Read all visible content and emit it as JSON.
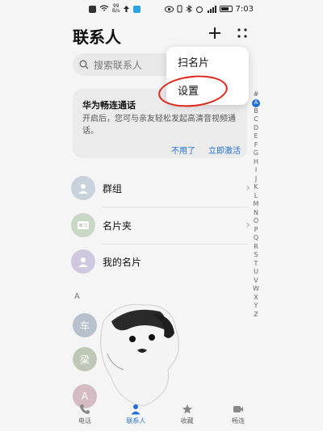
{
  "status_bar": {
    "net_speed": "99\nB/s",
    "time": "7:03"
  },
  "header": {
    "title": "联系人"
  },
  "search": {
    "placeholder": "搜索联系人"
  },
  "popup_menu": {
    "items": [
      "扫名片",
      "设置"
    ]
  },
  "promo": {
    "title": "华为畅连通话",
    "text": "开启后，您可与亲友轻松发起高清音视频通话。",
    "dismiss_label": "不用了",
    "activate_label": "立即激活"
  },
  "list": {
    "items": [
      {
        "label": "群组"
      },
      {
        "label": "名片夹"
      },
      {
        "label": "我的名片"
      }
    ]
  },
  "section": {
    "letter": "A"
  },
  "contacts": [
    {
      "initial": "车"
    },
    {
      "initial": "梁"
    },
    {
      "initial": "A"
    }
  ],
  "alphabet": [
    "#",
    "A",
    "B",
    "C",
    "D",
    "E",
    "F",
    "G",
    "H",
    "I",
    "J",
    "K",
    "L",
    "M",
    "N",
    "O",
    "P",
    "Q",
    "R",
    "S",
    "T",
    "U",
    "V",
    "W",
    "X",
    "Y",
    "Z"
  ],
  "alphabet_active": "A",
  "tabs": [
    {
      "label": "电话",
      "icon": "phone-icon"
    },
    {
      "label": "联系人",
      "icon": "person-icon",
      "active": true
    },
    {
      "label": "收藏",
      "icon": "star-icon"
    },
    {
      "label": "畅连",
      "icon": "video-icon"
    }
  ],
  "colors": {
    "accent": "#1f6fd6",
    "annotation": "#e2231a"
  }
}
